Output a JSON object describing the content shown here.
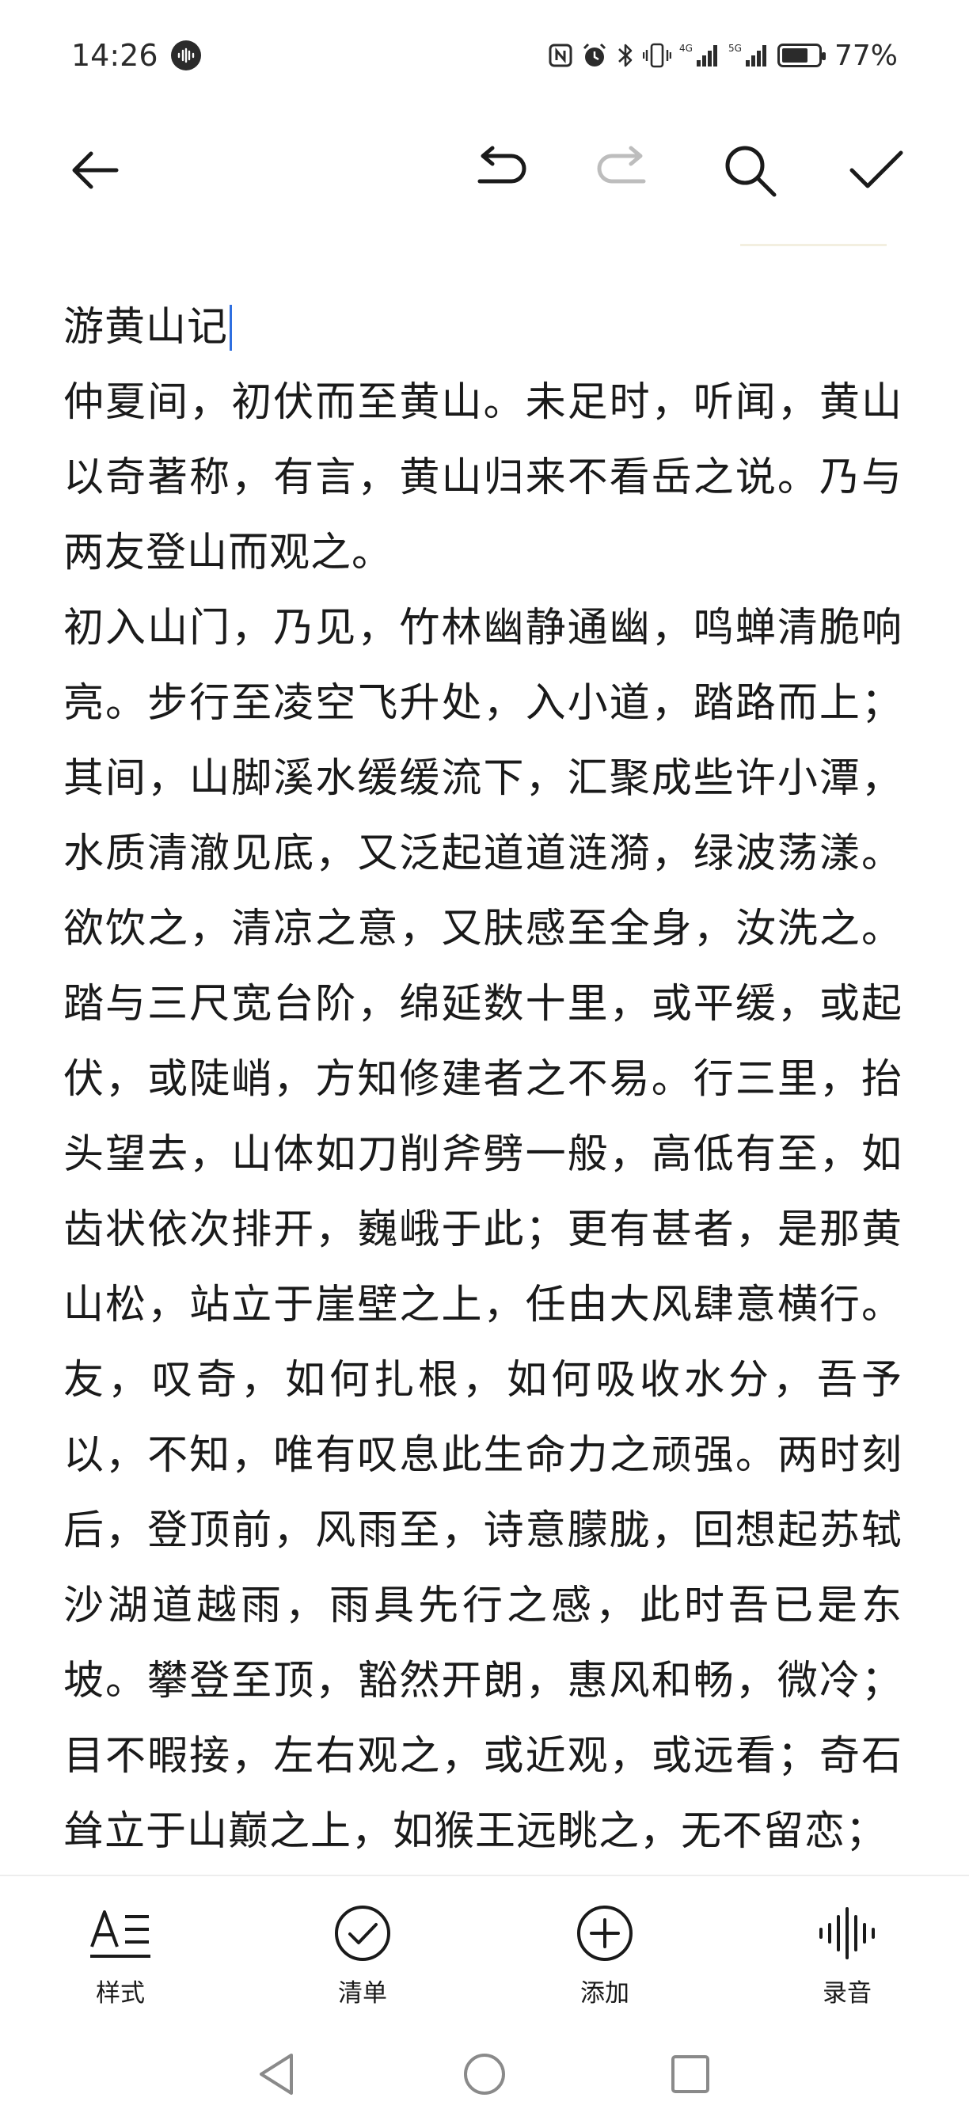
{
  "status_bar": {
    "time": "14:26",
    "network_1": "4G",
    "network_2": "5G",
    "battery_percent_text": "77%",
    "battery_level": 0.77,
    "icons": [
      "nfc-icon",
      "alarm-icon",
      "bluetooth-icon",
      "vibrate-icon",
      "signal-icon",
      "signal-icon",
      "battery-icon"
    ]
  },
  "toolbar": {
    "icons": [
      "back-arrow-icon",
      "undo-icon",
      "redo-icon",
      "search-icon",
      "check-icon"
    ],
    "redo_disabled": true
  },
  "note": {
    "title": "游黄山记",
    "body": "仲夏间，初伏而至黄山。未足时，听闻，黄山以奇著称，有言，黄山归来不看岳之说。乃与两友登山而观之。\n初入山门，乃见，竹林幽静通幽，鸣蝉清脆响亮。步行至凌空飞升处，入小道，踏路而上；其间，山脚溪水缓缓流下，汇聚成些许小潭，水质清澈见底，又泛起道道涟漪，绿波荡漾。欲饮之，清凉之意，又肤感至全身，汝洗之。踏与三尺宽台阶，绵延数十里，或平缓，或起伏，或陡峭，方知修建者之不易。行三里，抬头望去，山体如刀削斧劈一般，高低有至，如齿状依次排开，巍峨于此；更有甚者，是那黄山松，站立于崖壁之上，任由大风肆意横行。友，叹奇，如何扎根，如何吸收水分，吾予以，不知，唯有叹息此生命力之顽强。两时刻后，登顶前，风雨至，诗意朦胧，回想起苏轼沙湖道越雨，雨具先行之感，此时吾已是东坡。攀登至顶，豁然开朗，惠风和畅，微冷；目不暇接，左右观之，或近观，或远看；奇石耸立于山巅之上，如猴王远眺之，无不留恋；"
  },
  "bottom_actions": [
    {
      "label": "样式",
      "icon": "text-style-icon"
    },
    {
      "label": "清单",
      "icon": "checklist-icon"
    },
    {
      "label": "添加",
      "icon": "add-icon"
    },
    {
      "label": "录音",
      "icon": "voice-record-icon"
    }
  ],
  "nav_bar": {
    "icons": [
      "nav-back-icon",
      "nav-home-icon",
      "nav-recent-icon"
    ]
  },
  "colors": {
    "text": "#1a1a1a",
    "caret": "#2f6fe0",
    "disabled_icon": "#bdbdbd",
    "nav_icon": "#8a8a8a"
  }
}
